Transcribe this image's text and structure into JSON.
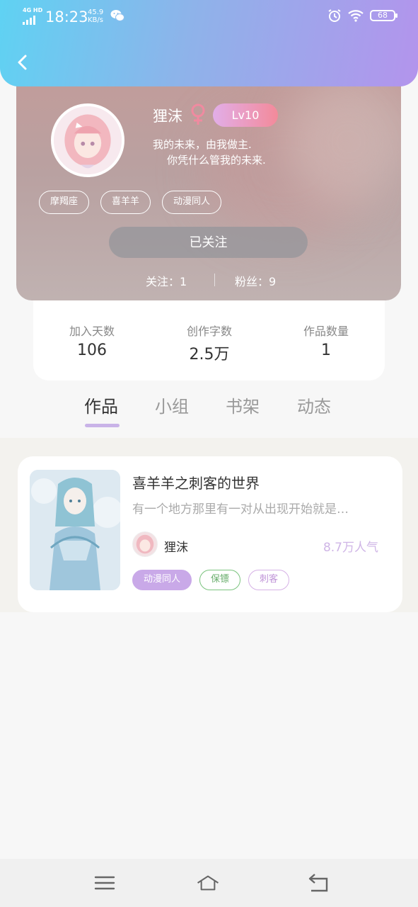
{
  "status_bar": {
    "network": "4G HD",
    "time": "18:23",
    "speed_value": "45.9",
    "speed_unit": "KB/s",
    "battery": "68",
    "icons": [
      "signal-icon",
      "wechat-icon",
      "alarm-icon",
      "wifi-icon",
      "battery-icon"
    ]
  },
  "header": {
    "back_icon": "chevron-left-icon",
    "gradient": [
      "#5fd2f3",
      "#b394ec"
    ]
  },
  "profile": {
    "name": "狸沫",
    "gender_icon": "female-icon",
    "level": "Lv10",
    "signature_line1": "我的未来，由我做主.",
    "signature_line2": "你凭什么管我的未来.",
    "tags": [
      "摩羯座",
      "喜羊羊",
      "动漫同人"
    ],
    "follow_button": "已关注",
    "following": "关注：1",
    "followers": "粉丝：9"
  },
  "stats": [
    {
      "label": "加入天数",
      "value": "106"
    },
    {
      "label": "创作字数",
      "value": "2.5万"
    },
    {
      "label": "作品数量",
      "value": "1"
    }
  ],
  "tabs": [
    "作品",
    "小组",
    "书架",
    "动态"
  ],
  "active_tab": 0,
  "works": [
    {
      "title": "喜羊羊之刺客的世界",
      "description": "有一个地方那里有一对从出现开始就是…",
      "author": "狸沫",
      "popularity": "8.7万人气",
      "tags": [
        "动漫同人",
        "保镖",
        "刺客"
      ]
    }
  ],
  "nav": [
    "menu-icon",
    "home-icon",
    "back-icon"
  ],
  "colors": {
    "accent": "#c9b3e8",
    "tag_green": "#7cc47f",
    "popularity": "#cfb5e6"
  }
}
